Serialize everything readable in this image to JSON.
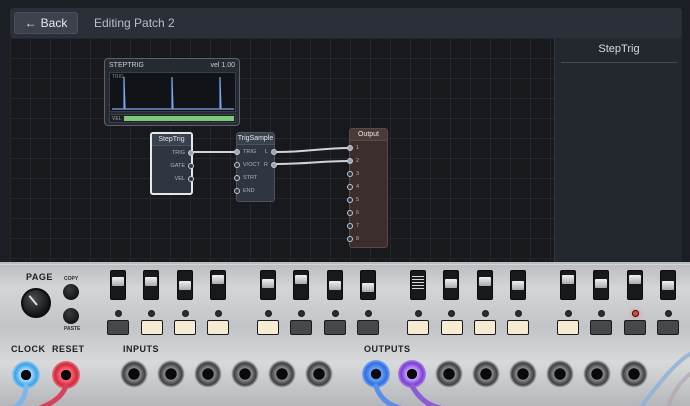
{
  "header": {
    "back_label": "Back",
    "back_icon": "arrow-left-icon",
    "title": "Editing Patch 2"
  },
  "side_panel": {
    "title": "StepTrig"
  },
  "scope": {
    "name": "STEPTRIG",
    "vel_readout": "vel 1.00",
    "trig_label": "TRIG",
    "vel_label": "VEL",
    "vel_level": 1.0,
    "bar_color": "#7fca78"
  },
  "nodes": {
    "steptrig": {
      "title": "StepTrig",
      "ports": [
        "TRIG",
        "GATE",
        "VEL"
      ]
    },
    "trigsample": {
      "title": "TrigSample",
      "inputs": [
        "TRIG",
        "V/OCT",
        "STRT",
        "END"
      ],
      "outputs": [
        "L",
        "R"
      ]
    },
    "output": {
      "title": "Output",
      "ports": [
        "1",
        "2",
        "3",
        "4",
        "5",
        "6",
        "7",
        "8"
      ]
    }
  },
  "hardware": {
    "page_label": "PAGE",
    "copy_label": "COPY",
    "paste_label": "PASTE",
    "clock_label": "CLOCK",
    "reset_label": "RESET",
    "inputs_label": "INPUTS",
    "outputs_label": "OUTPUTS",
    "steps": [
      false,
      true,
      true,
      true,
      true,
      false,
      false,
      true,
      true,
      true,
      true,
      true,
      false,
      false
    ],
    "active_led_index": 12,
    "colors": {
      "led_on": "#e0443d",
      "step_on": "#f6ecd4",
      "scope_fill": "#7fca78"
    }
  }
}
